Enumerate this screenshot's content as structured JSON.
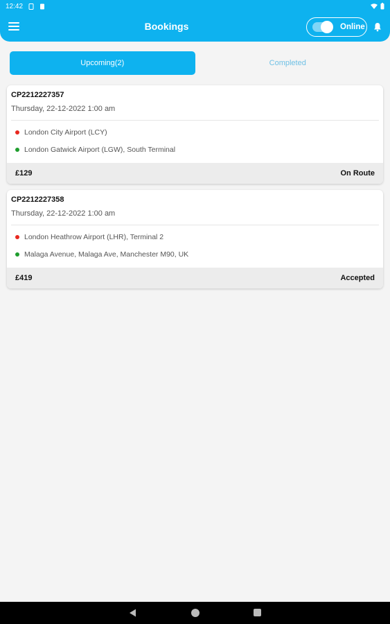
{
  "status_bar": {
    "time": "12:42"
  },
  "header": {
    "title": "Bookings",
    "online_label": "Online"
  },
  "tabs": [
    {
      "label": "Upcoming(2)",
      "active": true
    },
    {
      "label": "Completed",
      "active": false
    }
  ],
  "bookings": [
    {
      "id": "CP2212227357",
      "date": "Thursday, 22-12-2022 1:00 am",
      "pickup": "London City Airport (LCY)",
      "dropoff": "London Gatwick Airport (LGW), South Terminal",
      "price": "£129",
      "status": "On Route"
    },
    {
      "id": "CP2212227358",
      "date": "Thursday, 22-12-2022 1:00 am",
      "pickup": "London Heathrow Airport (LHR), Terminal 2",
      "dropoff": "Malaga Avenue, Malaga Ave, Manchester M90, UK",
      "price": "£419",
      "status": "Accepted"
    }
  ],
  "colors": {
    "primary": "#0eb2ef",
    "pickup_dot": "#e8281f",
    "dropoff_dot": "#1f9d2e"
  },
  "icons": [
    "menu-icon",
    "bell-icon",
    "back-icon",
    "home-icon",
    "recents-icon",
    "wifi-icon",
    "battery-icon"
  ]
}
